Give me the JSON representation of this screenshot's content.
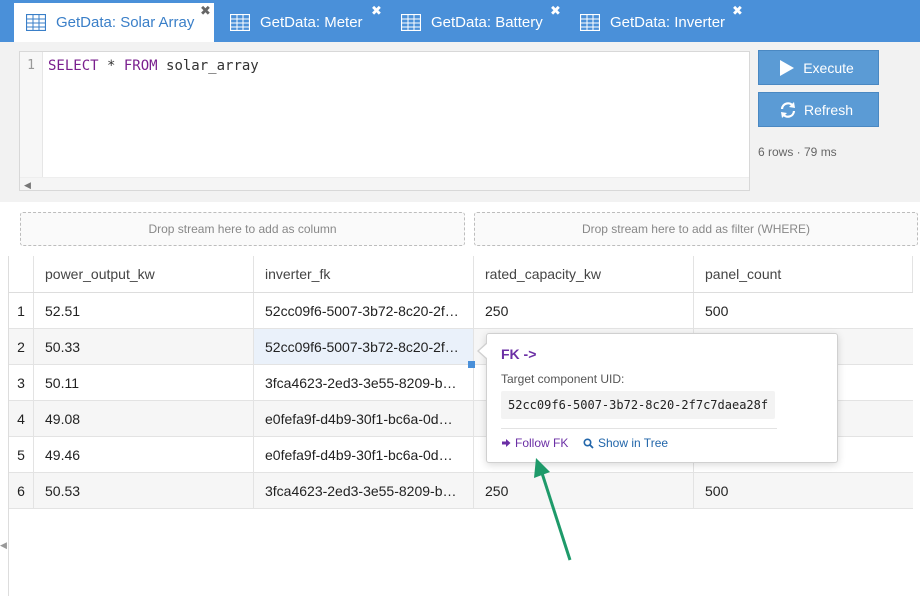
{
  "tabs": [
    {
      "label": "GetData: Solar Array",
      "active": true
    },
    {
      "label": "GetData: Meter",
      "active": false
    },
    {
      "label": "GetData: Battery",
      "active": false
    },
    {
      "label": "GetData: Inverter",
      "active": false
    }
  ],
  "editor": {
    "line_number": "1",
    "sql": {
      "kw1": "SELECT",
      "star": " * ",
      "kw2": "FROM",
      "table": " solar_array"
    }
  },
  "buttons": {
    "execute": "Execute",
    "refresh": "Refresh"
  },
  "stats": "6 rows · 79 ms",
  "dropzones": {
    "column": "Drop stream here to add as column",
    "filter": "Drop stream here to add as filter (WHERE)"
  },
  "table": {
    "columns": [
      "power_output_kw",
      "inverter_fk",
      "rated_capacity_kw",
      "panel_count"
    ],
    "rows": [
      {
        "n": "1",
        "power": "52.51",
        "fk": "52cc09f6-5007-3b72-8c20-2f7c7daea28f",
        "rated": "250",
        "panels": "500"
      },
      {
        "n": "2",
        "power": "50.33",
        "fk": "52cc09f6-5007-3b72-8c20-2f7c7daea28f",
        "rated": "",
        "panels": ""
      },
      {
        "n": "3",
        "power": "50.11",
        "fk": "3fca4623-2ed3-3e55-8209-b…",
        "rated": "",
        "panels": ""
      },
      {
        "n": "4",
        "power": "49.08",
        "fk": "e0fefa9f-d4b9-30f1-bc6a-0d…",
        "rated": "",
        "panels": ""
      },
      {
        "n": "5",
        "power": "49.46",
        "fk": "e0fefa9f-d4b9-30f1-bc6a-0d…",
        "rated": "",
        "panels": ""
      },
      {
        "n": "6",
        "power": "50.53",
        "fk": "3fca4623-2ed3-3e55-8209-b…",
        "rated": "250",
        "panels": "500"
      }
    ]
  },
  "popover": {
    "title": "FK ->",
    "label": "Target component UID:",
    "uid": "52cc09f6-5007-3b72-8c20-2f7c7daea28f",
    "follow": "Follow FK",
    "tree": "Show in Tree"
  },
  "colors": {
    "accent": "#4a90d9",
    "fk_purple": "#6b2fa5",
    "annotation": "#1e9a6a"
  }
}
